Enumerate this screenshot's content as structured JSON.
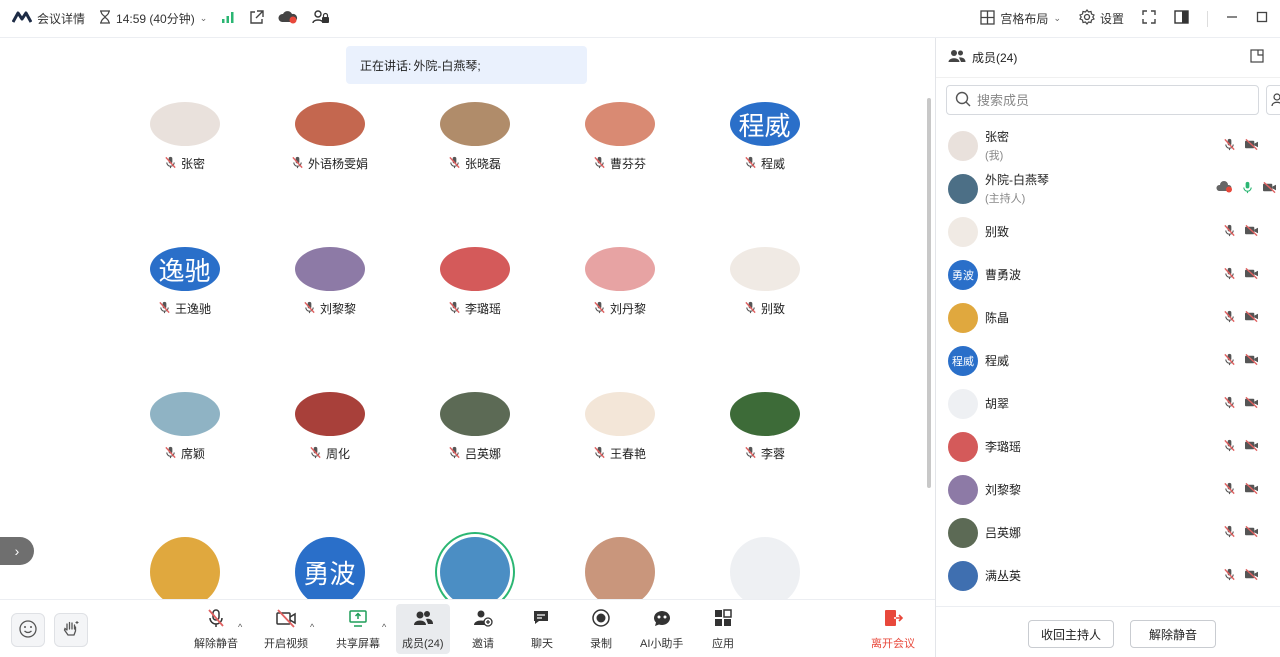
{
  "topbar": {
    "logo": "logo-icon",
    "meeting_info": "会议详情",
    "time": "14:59 (40分钟)",
    "layout": "宫格布局",
    "settings": "设置"
  },
  "stage": {
    "speaking_label": "正在讲话:",
    "speaking_name": "外院-白燕琴;"
  },
  "participants": [
    {
      "name": "张密",
      "avatar_text": "",
      "color": "#e9e1dc"
    },
    {
      "name": "外语杨雯娟",
      "avatar_text": "",
      "color": "#c4674f"
    },
    {
      "name": "张晓磊",
      "avatar_text": "",
      "color": "#b08c6a"
    },
    {
      "name": "曹芬芬",
      "avatar_text": "",
      "color": "#d98a73"
    },
    {
      "name": "程威",
      "avatar_text": "程威",
      "color": "#2a6fc9"
    },
    {
      "name": "王逸驰",
      "avatar_text": "逸驰",
      "color": "#2a6fc9"
    },
    {
      "name": "刘黎黎",
      "avatar_text": "",
      "color": "#8d7aa6"
    },
    {
      "name": "李璐瑶",
      "avatar_text": "",
      "color": "#d45a5a"
    },
    {
      "name": "刘丹黎",
      "avatar_text": "",
      "color": "#e7a3a3"
    },
    {
      "name": "别致",
      "avatar_text": "",
      "color": "#f0eae4"
    },
    {
      "name": "席颖",
      "avatar_text": "",
      "color": "#8fb3c4"
    },
    {
      "name": "周化",
      "avatar_text": "",
      "color": "#a8403a"
    },
    {
      "name": "吕英娜",
      "avatar_text": "",
      "color": "#5c6a55"
    },
    {
      "name": "王春艳",
      "avatar_text": "",
      "color": "#f3e6d8"
    },
    {
      "name": "李蓉",
      "avatar_text": "",
      "color": "#3d6b38"
    },
    {
      "name": "",
      "avatar_text": "",
      "color": "#e0a83e"
    },
    {
      "name": "",
      "avatar_text": "勇波",
      "color": "#2a6fc9"
    },
    {
      "name": "",
      "avatar_text": "",
      "color": "#4b8ec4"
    },
    {
      "name": "",
      "avatar_text": "",
      "color": "#c9967c"
    },
    {
      "name": "",
      "avatar_text": "",
      "color": "#eef0f3"
    }
  ],
  "toolbar": {
    "unmute": "解除静音",
    "start_video": "开启视频",
    "share": "共享屏幕",
    "members": "成员(24)",
    "invite": "邀请",
    "chat": "聊天",
    "record": "录制",
    "ai": "AI小助手",
    "apps": "应用",
    "leave": "离开会议"
  },
  "panel": {
    "title": "成员(24)",
    "search_placeholder": "搜索成员",
    "members": [
      {
        "name": "张密",
        "sub": "(我)",
        "avatar_text": "",
        "color": "#e9e1dc"
      },
      {
        "name": "外院-白燕琴",
        "sub": "(主持人)",
        "avatar_text": "",
        "color": "#4c6f86"
      },
      {
        "name": "别致",
        "sub": "",
        "avatar_text": "",
        "color": "#f0eae4"
      },
      {
        "name": "曹勇波",
        "sub": "",
        "avatar_text": "勇波",
        "color": "#2a6fc9"
      },
      {
        "name": "陈晶",
        "sub": "",
        "avatar_text": "",
        "color": "#e0a83e"
      },
      {
        "name": "程威",
        "sub": "",
        "avatar_text": "程威",
        "color": "#2a6fc9"
      },
      {
        "name": "胡翠",
        "sub": "",
        "avatar_text": "",
        "color": "#eef0f3"
      },
      {
        "name": "李璐瑶",
        "sub": "",
        "avatar_text": "",
        "color": "#d45a5a"
      },
      {
        "name": "刘黎黎",
        "sub": "",
        "avatar_text": "",
        "color": "#8d7aa6"
      },
      {
        "name": "吕英娜",
        "sub": "",
        "avatar_text": "",
        "color": "#5c6a55"
      },
      {
        "name": "满丛英",
        "sub": "",
        "avatar_text": "",
        "color": "#3f6fb0"
      }
    ],
    "reclaim_host": "收回主持人",
    "unmute_all": "解除静音"
  },
  "colors": {
    "accent": "#2a6fc9",
    "leave": "#e8483b",
    "speaking_ring": "#2bb673",
    "mic_on": "#2bb673",
    "muted": "#e06060"
  }
}
